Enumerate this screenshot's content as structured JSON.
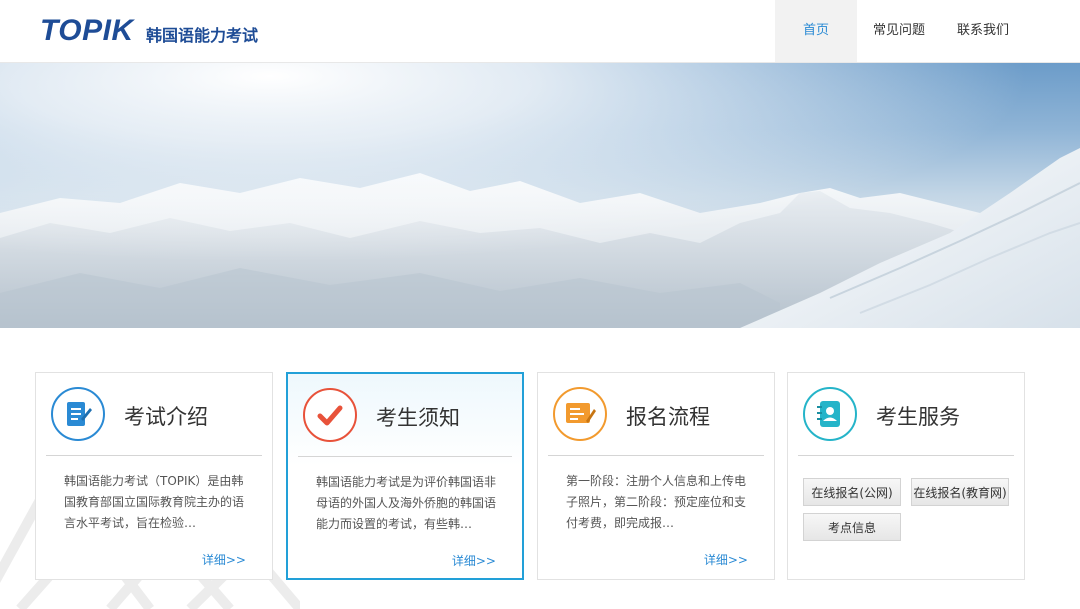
{
  "header": {
    "logo": "TOPIK",
    "site_name": "韩国语能力考试",
    "nav": [
      "首页",
      "常见问题",
      "联系我们"
    ]
  },
  "colors": {
    "brand": "#1e4c96",
    "accent": "#2a8ad4",
    "highlight_border": "#22a0d8"
  },
  "cards": [
    {
      "title": "考试介绍",
      "icon": "document-edit-icon",
      "text": "韩国语能力考试（TOPIK）是由韩国教育部国立国际教育院主办的语言水平考试，旨在检验…",
      "more": "详细>>"
    },
    {
      "title": "考生须知",
      "icon": "checkmark-icon",
      "text": "韩国语能力考试是为评价韩国语非母语的外国人及海外侨胞的韩国语能力而设置的考试，有些韩…",
      "more": "详细>>"
    },
    {
      "title": "报名流程",
      "icon": "form-pen-icon",
      "text": "第一阶段：注册个人信息和上传电子照片，第二阶段：预定座位和支付考费，即完成报…",
      "more": "详细>>"
    },
    {
      "title": "考生服务",
      "icon": "contact-book-icon",
      "buttons": [
        "在线报名(公网)",
        "在线报名(教育网)",
        "考点信息"
      ]
    }
  ]
}
